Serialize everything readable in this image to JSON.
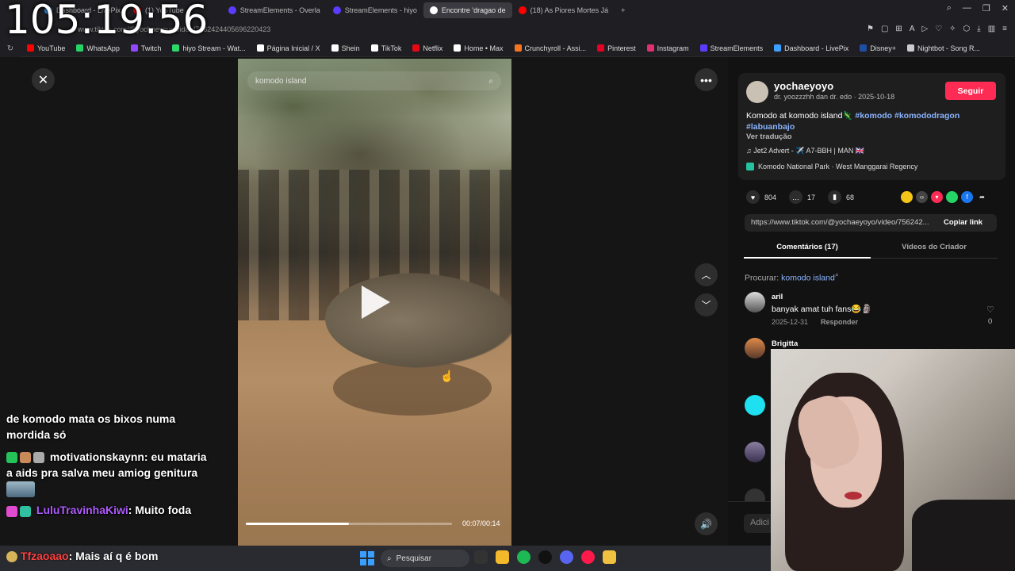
{
  "clock": "105:19:56",
  "browser": {
    "tabs": [
      {
        "label": "Dashboard - LivePix",
        "color": "#3ba0ff"
      },
      {
        "label": "(1) YouTube",
        "color": "#ff0000"
      },
      {
        "label": "StreamElements - Overla",
        "color": "#5b3cff"
      },
      {
        "label": "StreamElements - hiyo",
        "color": "#5b3cff"
      },
      {
        "label": "Encontre 'dragao de",
        "color": "#ffffff",
        "active": true
      },
      {
        "label": "(18) As Piores Mortes Já",
        "color": "#ff0000"
      }
    ],
    "new_tab": "+",
    "url": "www.tiktok.com/@yochaeyoyo/video/7562424405696220423",
    "bookmarks": [
      {
        "label": "YouTube",
        "color": "#ff0000"
      },
      {
        "label": "WhatsApp",
        "color": "#25d366"
      },
      {
        "label": "Twitch",
        "color": "#9146ff"
      },
      {
        "label": "hiyo Stream - Wat...",
        "color": "#2bd96b"
      },
      {
        "label": "Página Inicial / X",
        "color": "#ffffff"
      },
      {
        "label": "Shein",
        "color": "#ffffff"
      },
      {
        "label": "TikTok",
        "color": "#ffffff"
      },
      {
        "label": "Netflix",
        "color": "#e50914"
      },
      {
        "label": "Home • Max",
        "color": "#ffffff"
      },
      {
        "label": "Crunchyroll - Assi...",
        "color": "#f47521"
      },
      {
        "label": "Pinterest",
        "color": "#e60023"
      },
      {
        "label": "Instagram",
        "color": "#e1306c"
      },
      {
        "label": "StreamElements",
        "color": "#5b3cff"
      },
      {
        "label": "Dashboard - LivePix",
        "color": "#3ba0ff"
      },
      {
        "label": "Disney+",
        "color": "#1f4ea3"
      },
      {
        "label": "Nightbot - Song R...",
        "color": "#cccccc"
      }
    ]
  },
  "video": {
    "search_text": "komodo island",
    "time": "00:07/00:14",
    "progress_fraction": 0.5
  },
  "post": {
    "username": "yochaeyoyo",
    "subline": "dr. yoozzzhh dan dr. edo · 2025-10-18",
    "follow_label": "Seguir",
    "caption_text": "Komodo at komodo island🦎",
    "tags": [
      "#komodo",
      "#komododragon",
      "#labuanbajo"
    ],
    "translate": "Ver tradução",
    "music": "♫  Jet2 Advert - ✈️ A7-BBH | MAN 🇬🇧",
    "place": "Komodo National Park · West Manggarai Regency",
    "likes": "804",
    "comments": "17",
    "saves": "68",
    "link": "https://www.tiktok.com/@yochaeyoyo/video/756242...",
    "copy_label": "Copiar link",
    "tab_comments": "Comentários (17)",
    "tab_videos": "Vídeos do Criador",
    "search_label": "Procurar:",
    "search_term": "komodo island",
    "add_comment_placeholder": "Adici"
  },
  "comments": [
    {
      "name": "aril",
      "text": "banyak amat tuh fans😂🗿",
      "date": "2025-12-31",
      "reply": "Responder",
      "likes": "0"
    },
    {
      "name": "Brigitta",
      "text": "",
      "date": "",
      "reply": "",
      "likes": ""
    }
  ],
  "chat": [
    {
      "user": "",
      "text": "de komodo mata os bixos numa mordida só"
    },
    {
      "user": "motivationskaynn",
      "text": "eu mataria a aids pra salva meu amiog genitura"
    },
    {
      "user": "LuluTravinhaKiwi",
      "text": "Muito foda"
    }
  ],
  "taskbar": {
    "chat_user": "Tfzaoaao",
    "chat_text": "Mais aí q é bom",
    "search_label": "Pesquisar"
  },
  "colors": {
    "accent": "#fe2c55",
    "link": "#8ab4ff"
  }
}
